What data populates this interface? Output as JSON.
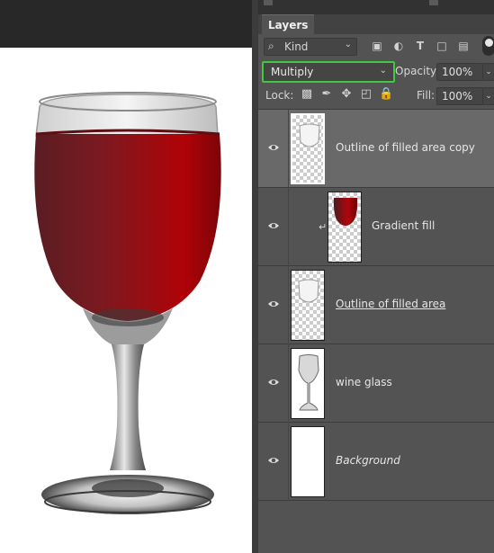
{
  "panel": {
    "tab_label": "Layers",
    "filter": {
      "label": "Kind",
      "icons": [
        "image-filter-icon",
        "adjustment-filter-icon",
        "type-filter-icon",
        "shape-filter-icon",
        "smart-object-filter-icon"
      ]
    },
    "blend_mode": "Multiply",
    "opacity_label": "Opacity:",
    "opacity_value": "100%",
    "lock_label": "Lock:",
    "fill_label": "Fill:",
    "fill_value": "100%",
    "highlight_color": "#3ec93e"
  },
  "layers": [
    {
      "name": "Outline of filled area  copy",
      "visible": true,
      "selected": true
    },
    {
      "name": "Gradient fill",
      "visible": true,
      "clipped": true
    },
    {
      "name": "Outline of filled area",
      "visible": true,
      "underline": true
    },
    {
      "name": "wine glass",
      "visible": true
    },
    {
      "name": "Background",
      "visible": true,
      "italic": true
    }
  ],
  "canvas": {
    "background": "#ffffff",
    "wine_color": "#8b0a0f"
  }
}
